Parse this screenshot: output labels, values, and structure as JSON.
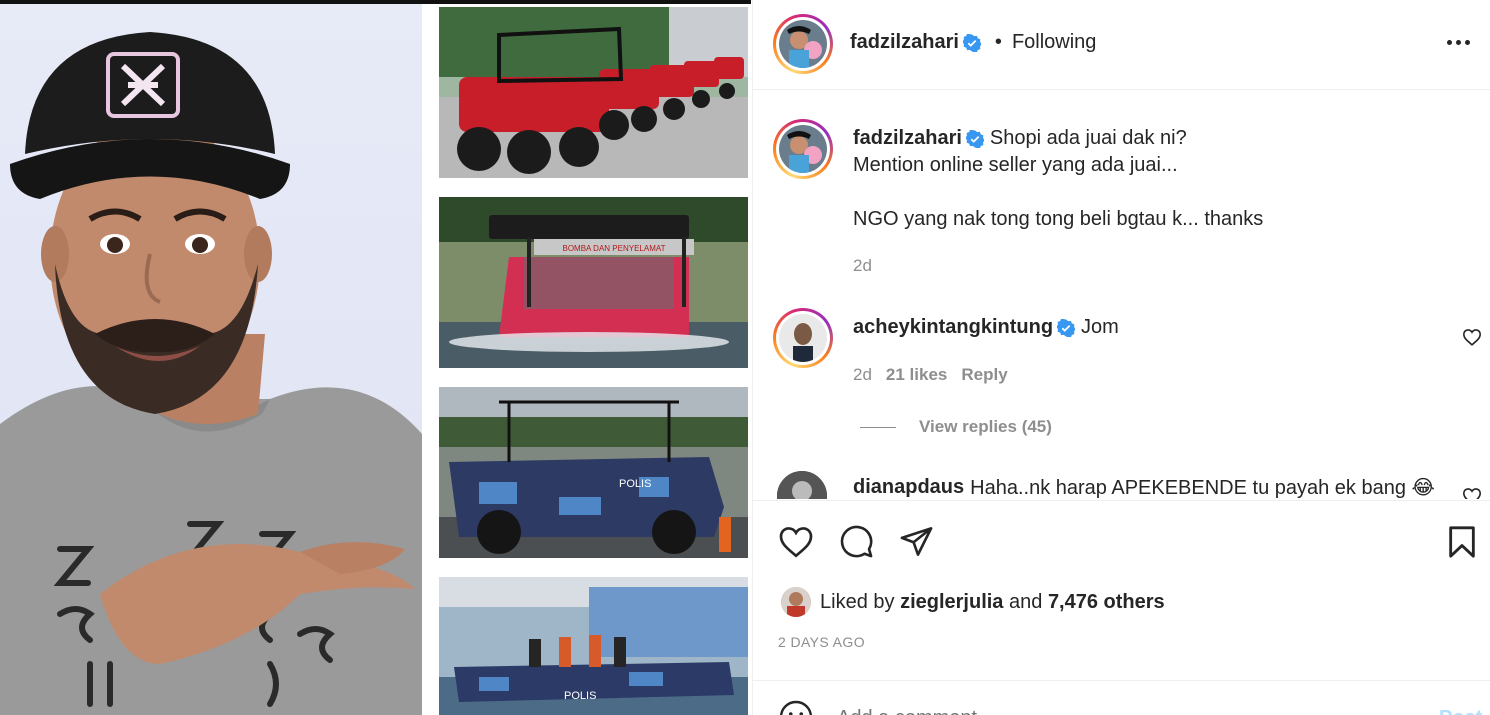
{
  "post": {
    "author": "fadzilzahari",
    "separator": "•",
    "follow_status": "Following"
  },
  "caption": {
    "author": "fadzilzahari",
    "line1": "Shopi ada juai dak ni?",
    "line2": "Mention online seller yang ada juai...",
    "line3": "NGO yang nak tong tong beli bgtau k... thanks",
    "time": "2d"
  },
  "comments": [
    {
      "author": "acheykintangkintung",
      "text": "Jom",
      "time": "2d",
      "likes": "21 likes",
      "reply_label": "Reply",
      "view_replies": "View replies (45)"
    },
    {
      "author": "dianapdaus",
      "text": "Haha..nk harap APEKEBENDE tu payah ek bang 😂"
    }
  ],
  "likes": {
    "prefix": "Liked by",
    "user": "zieglerjulia",
    "joiner": "and",
    "others": "7,476 others"
  },
  "timestamp": "2 DAYS AGO",
  "composer": {
    "placeholder": "Add a comment...",
    "post_label": "Post"
  },
  "media": {
    "vehicle_labels": [
      "POLIS",
      "POLIS"
    ],
    "banner_text": "BOMBA DAN PENYELAMAT"
  },
  "colors": {
    "verified": "#3897f0",
    "text": "#262626",
    "muted": "#8e8e8e",
    "link": "#b2dffc"
  }
}
